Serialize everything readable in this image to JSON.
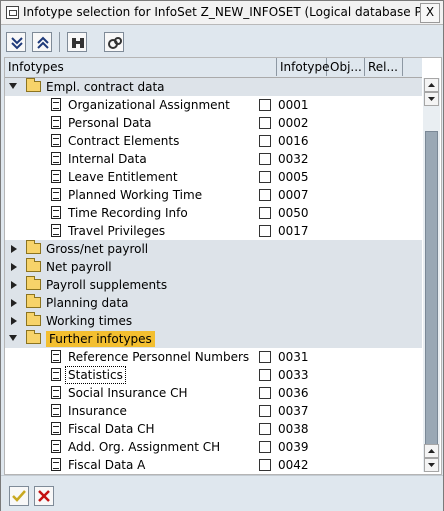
{
  "window": {
    "title": "Infotype selection for InfoSet Z_NEW_INFOSET (Logical database P",
    "close_label": "X"
  },
  "toolbar": {
    "buttons": [
      "expand-all-icon",
      "collapse-all-icon",
      "find-icon",
      "find-next-icon"
    ]
  },
  "tree": {
    "headers": {
      "infotypes": "Infotypes",
      "infotype": "Infotype",
      "obj": "Obj...",
      "rel": "Rel..."
    },
    "nodes": [
      {
        "label": "Empl. contract data",
        "expanded": true
      },
      {
        "label": "Organizational Assignment",
        "code": "0001"
      },
      {
        "label": "Personal Data",
        "code": "0002"
      },
      {
        "label": "Contract Elements",
        "code": "0016"
      },
      {
        "label": "Internal Data",
        "code": "0032"
      },
      {
        "label": "Leave Entitlement",
        "code": "0005"
      },
      {
        "label": "Planned Working Time",
        "code": "0007"
      },
      {
        "label": "Time Recording Info",
        "code": "0050"
      },
      {
        "label": "Travel Privileges",
        "code": "0017"
      },
      {
        "label": "Gross/net payroll",
        "expanded": false
      },
      {
        "label": "Net payroll",
        "expanded": false
      },
      {
        "label": "Payroll supplements",
        "expanded": false
      },
      {
        "label": "Planning data",
        "expanded": false
      },
      {
        "label": "Working times",
        "expanded": false
      },
      {
        "label": "Further infotypes",
        "expanded": true
      },
      {
        "label": "Reference Personnel Numbers",
        "code": "0031"
      },
      {
        "label": "Statistics",
        "code": "0033"
      },
      {
        "label": "Social Insurance CH",
        "code": "0036"
      },
      {
        "label": "Insurance",
        "code": "0037"
      },
      {
        "label": "Fiscal Data  CH",
        "code": "0038"
      },
      {
        "label": "Add. Org. Assignment  CH",
        "code": "0039"
      },
      {
        "label": "Fiscal Data  A",
        "code": "0042"
      }
    ]
  },
  "footer": {
    "buttons": [
      "checkmark-icon",
      "cancel-x-icon"
    ]
  },
  "colors": {
    "highlight": "#f3bf30",
    "folder": "#f7d36a",
    "panel": "#dfe7ee"
  }
}
